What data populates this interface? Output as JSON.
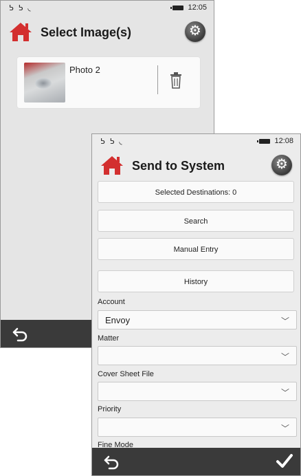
{
  "screen1": {
    "status": {
      "icons": "ᕊ ᕊ ◟",
      "time": "12:05"
    },
    "title": "Select Image(s)",
    "photo": {
      "name": "Photo 2"
    }
  },
  "screen2": {
    "status": {
      "icons": "ᕊ ᕊ ◟",
      "time": "12:08"
    },
    "title": "Send to System",
    "buttons": {
      "destinations": "Selected Destinations: 0",
      "search": "Search",
      "manual": "Manual Entry",
      "history": "History"
    },
    "fields": [
      {
        "label": "Account",
        "value": "Envoy"
      },
      {
        "label": "Matter",
        "value": ""
      },
      {
        "label": "Cover Sheet File",
        "value": ""
      },
      {
        "label": "Priority",
        "value": ""
      },
      {
        "label": "Fine Mode",
        "value": ""
      }
    ]
  },
  "icons": [
    "home-icon",
    "gear-icon",
    "trash-icon",
    "back-icon",
    "checkmark-icon",
    "chevron-down-icon",
    "battery-icon"
  ],
  "colors": {
    "home_red": "#d32f2f",
    "bar_dark": "#3a3a3a"
  }
}
